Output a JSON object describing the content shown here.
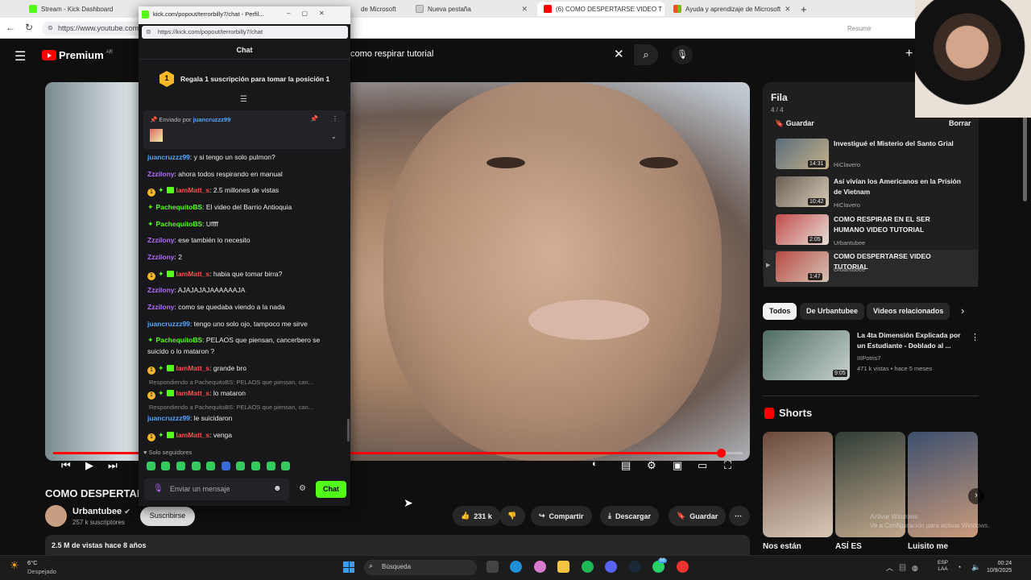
{
  "browser": {
    "tabs": [
      {
        "label": "Stream - Kick Dashboard",
        "icon": "kick-icon",
        "active": false
      },
      {
        "label": "(6) COMO DESPERTARSE VIDEO T",
        "icon": "youtube-icon",
        "active": true
      },
      {
        "label": "de Microsoft",
        "icon": "microsoft-icon",
        "active": false
      },
      {
        "label": "Nueva pestaña",
        "icon": "new-tab-icon",
        "active": false
      },
      {
        "label": "Ayuda y aprendizaje de Microsoft",
        "icon": "microsoft-icon",
        "active": false
      }
    ],
    "url": "https://www.youtube.com",
    "resumir": "Resumir"
  },
  "youtube": {
    "brand": "Premium",
    "country": "AR",
    "search_query": "como respirar tutorial",
    "video": {
      "title": "COMO DESPERTAR",
      "progress": 0.97,
      "channel": "Urbantubee",
      "subscribers": "257 k suscriptores",
      "subscribe": "Suscribirse",
      "likes": "231 k",
      "share": "Compartir",
      "download": "Descargar",
      "save": "Guardar",
      "description": "2.5 M de vistas  hace 8 años"
    },
    "queue": {
      "title": "Fila",
      "count": "4 / 4",
      "save": "Guardar",
      "clear": "Borrar",
      "items": [
        {
          "title": "Investigué el Misterio del Santo Grial",
          "channel": "HiClavero",
          "duration": "14:31",
          "current": false
        },
        {
          "title": "Así vivían los Americanos en la Prisión de Vietnam",
          "channel": "HiClavero",
          "duration": "10:42",
          "current": false
        },
        {
          "title": "COMO RESPIRAR EN EL SER HUMANO VIDEO TUTORIAL",
          "channel": "Urbantubee",
          "duration": "2:05",
          "current": false
        },
        {
          "title": "COMO DESPERTARSE VIDEO TUTORIAL",
          "channel": "Urbantubee",
          "duration": "1:47",
          "current": true
        }
      ]
    },
    "chips": [
      "Todos",
      "De Urbantubee",
      "Videos relacionados"
    ],
    "recommended": {
      "title": "La 4ta Dimensión Explicada por un Estudiante - Doblado al ...",
      "channel": "IIIPotris7",
      "meta": "471 k vistas • hace 5 meses",
      "duration": "9:05"
    },
    "shorts": {
      "label": "Shorts",
      "items": [
        {
          "title": "Nos están"
        },
        {
          "title": "ASÍ ES"
        },
        {
          "title": "Luisito me"
        }
      ]
    },
    "activate_windows": [
      "Activar Windows",
      "Ve a Configuración para activar Windows."
    ]
  },
  "kick": {
    "window_title": "kick.com/popout/terrorbilly7/chat - Perfil...",
    "url": "https://kick.com/popout/terrorbilly7/chat",
    "chat_header": "Chat",
    "goal_rank": "1",
    "goal_text": "Regala 1 suscripción para tomar la posición 1",
    "pinned": {
      "label": "Enviado por",
      "user": "juancruzzz99"
    },
    "messages": [
      {
        "user": "juancruzzz99",
        "color": "#53a7ff",
        "text": ": y si tengo un solo pulmon?",
        "badges": []
      },
      {
        "user": "Zzzilony",
        "color": "#b46bff",
        "text": ": ahora todos respirando en manual",
        "badges": []
      },
      {
        "user": "IamMatt_s",
        "color": "#ff4d4d",
        "text": ": 2.5 millones de vistas",
        "badges": [
          "b1",
          "b2",
          "b3"
        ]
      },
      {
        "user": "PachequitoBS",
        "color": "#53fc18",
        "text": ": El video del Barrio Antioquia",
        "badges": [
          "b2"
        ]
      },
      {
        "user": "PachequitoBS",
        "color": "#53fc18",
        "text": ": Uffff",
        "badges": [
          "b2"
        ]
      },
      {
        "user": "Zzzilony",
        "color": "#b46bff",
        "text": ": ese también lo necesito",
        "badges": []
      },
      {
        "user": "Zzzilony",
        "color": "#b46bff",
        "text": ": 2",
        "badges": []
      },
      {
        "user": "IamMatt_s",
        "color": "#ff4d4d",
        "text": ": habia que tomar birra?",
        "badges": [
          "b1",
          "b2",
          "b3"
        ]
      },
      {
        "user": "Zzzilony",
        "color": "#b46bff",
        "text": ": AJAJAJAJAAAAAAJA",
        "badges": []
      },
      {
        "user": "Zzzilony",
        "color": "#b46bff",
        "text": ": como se quedaba viendo a la nada",
        "badges": []
      },
      {
        "user": "juancruzzz99",
        "color": "#53a7ff",
        "text": ": tengo uno solo ojo, tampoco me sirve",
        "badges": []
      },
      {
        "user": "PachequitoBS",
        "color": "#53fc18",
        "text": ": PELAOS que piensan, cancerbero se suicido o lo mataron ?",
        "badges": [
          "b2"
        ]
      },
      {
        "user": "IamMatt_s",
        "color": "#ff4d4d",
        "text": ": grande bro",
        "badges": [
          "b1",
          "b2",
          "b3"
        ]
      },
      {
        "reply": "Respondiendo a PachequitoBS: PELAOS que piensan, can..."
      },
      {
        "user": "IamMatt_s",
        "color": "#ff4d4d",
        "text": ": lo mataron",
        "badges": [
          "b1",
          "b2",
          "b3"
        ]
      },
      {
        "reply": "Respondiendo a PachequitoBS: PELAOS que piensan, can..."
      },
      {
        "user": "juancruzzz99",
        "color": "#53a7ff",
        "text": ": le suicidaron",
        "badges": []
      },
      {
        "user": "IamMatt_s",
        "color": "#ff4d4d",
        "text": ": venga",
        "badges": [
          "b1",
          "b2",
          "b3"
        ]
      }
    ],
    "followers_only": "Solo seguidores",
    "input_placeholder": "Enviar un mensaje",
    "send": "Chat"
  },
  "taskbar": {
    "temp": "6°C",
    "condition": "Despejado",
    "search": "Búsqueda",
    "lang": [
      "ESP",
      "LAA"
    ],
    "time": "00:24",
    "date": "10/9/2025",
    "badge": "86"
  },
  "colors": {
    "youtube_red": "#ff0000",
    "kick_green": "#53fc18",
    "accent_blue": "#3a9df0"
  }
}
